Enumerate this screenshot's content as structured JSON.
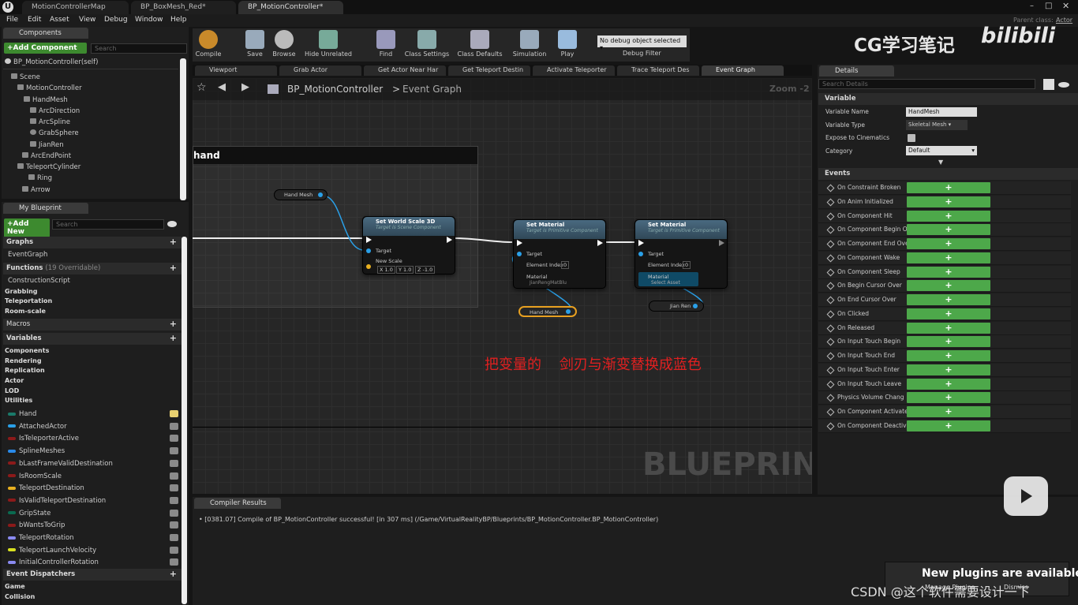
{
  "window": {
    "tabs": [
      "MotionControllerMap",
      "BP_BoxMesh_Red*",
      "BP_MotionController*"
    ],
    "parent_class_label": "Parent class:",
    "parent_class_value": "Actor"
  },
  "menu": [
    "File",
    "Edit",
    "Asset",
    "View",
    "Debug",
    "Window",
    "Help"
  ],
  "components_panel": {
    "title": "Components",
    "add_button": "+Add Component",
    "search_placeholder": "Search",
    "self_item": "BP_MotionController(self)",
    "tree": [
      "Scene",
      "MotionController",
      "HandMesh",
      "ArcDirection",
      "ArcSpline",
      "GrabSphere",
      "JianRen",
      "ArcEndPoint",
      "TeleportCylinder",
      "Ring",
      "Arrow"
    ]
  },
  "my_blueprint": {
    "title": "My Blueprint",
    "add_new": "+Add New",
    "search_placeholder": "Search",
    "graphs_label": "Graphs",
    "event_graph": "EventGraph",
    "functions_label": "Functions",
    "functions_overridable": "(19 Overridable)",
    "functions": [
      "ConstructionScript",
      "Grabbing",
      "Teleportation",
      "Room-scale"
    ],
    "macros_label": "Macros",
    "variables_label": "Variables",
    "variable_categories": [
      "Components",
      "Rendering",
      "Replication",
      "Actor",
      "LOD",
      "Utilities"
    ],
    "variables": [
      {
        "name": "Hand",
        "color": "#1a7a6a"
      },
      {
        "name": "AttachedActor",
        "color": "#2aa0e8"
      },
      {
        "name": "IsTeleporterActive",
        "color": "#8c1a1a"
      },
      {
        "name": "SplineMeshes",
        "color": "#2a8ae8"
      },
      {
        "name": "bLastFrameValidDestination",
        "color": "#8c1a1a"
      },
      {
        "name": "IsRoomScale",
        "color": "#8c1a1a"
      },
      {
        "name": "TeleportDestination",
        "color": "#e8b020"
      },
      {
        "name": "IsValidTeleportDestination",
        "color": "#8c1a1a"
      },
      {
        "name": "GripState",
        "color": "#0a6a50"
      },
      {
        "name": "bWantsToGrip",
        "color": "#8c1a1a"
      },
      {
        "name": "TeleportRotation",
        "color": "#8a8af0"
      },
      {
        "name": "TeleportLaunchVelocity",
        "color": "#d8e020"
      },
      {
        "name": "InitialControllerRotation",
        "color": "#8a8af0"
      }
    ],
    "event_dispatchers_label": "Event Dispatchers",
    "dispatcher_categories": [
      "Game",
      "Collision"
    ]
  },
  "toolbar": {
    "items": [
      "Compile",
      "Save",
      "Browse",
      "Hide Unrelated",
      "Find",
      "Class Settings",
      "Class Defaults",
      "Simulation",
      "Play"
    ],
    "debug_object": "No debug object selected",
    "debug_filter": "Debug Filter"
  },
  "watermark": {
    "cg_text": "CG学习笔记",
    "bili": "bilibili"
  },
  "graph_tabs": [
    "Viewport",
    "Grab Actor",
    "Get Actor Near Har",
    "Get Teleport Destin",
    "Activate Teleporter",
    "Trace Teleport Des",
    "Event Graph"
  ],
  "graph": {
    "breadcrumb_root": "BP_MotionController",
    "breadcrumb_leaf": "Event Graph",
    "zoom": "Zoom -2",
    "comment_title": "hand",
    "watermark": "BLUEPRINT",
    "annotation": "把变量的    剑刃与渐变替换成蓝色",
    "nodes": {
      "set_world_scale": {
        "title": "Set World Scale 3D",
        "subtitle": "Target is Scene Component",
        "target": "Target",
        "new_scale": "New Scale",
        "x": "1.0",
        "y": "1.0",
        "z": "-1.0"
      },
      "set_material_1": {
        "title": "Set Material",
        "subtitle": "Target is Primitive Component",
        "target": "Target",
        "element_index": "Element Index",
        "index_value": "0",
        "material": "Material",
        "material_value": "JianRengMatBlu"
      },
      "set_material_2": {
        "title": "Set Material",
        "subtitle": "Target is Primitive Component",
        "target": "Target",
        "element_index": "Element Index",
        "index_value": "0",
        "material": "Material",
        "material_value": "Select Asset"
      },
      "hand_mesh_1": "Hand Mesh",
      "hand_mesh_2": "Hand Mesh",
      "jian_ren": "Jian Ren"
    }
  },
  "details": {
    "title": "Details",
    "search_placeholder": "Search Details",
    "variable_section": "Variable",
    "fields": [
      {
        "label": "Variable Name",
        "value": "HandMesh"
      },
      {
        "label": "Variable Type",
        "value": "Skeletal Mesh"
      },
      {
        "label": "Expose to Cinematics",
        "value": ""
      },
      {
        "label": "Category",
        "value": "Default"
      }
    ],
    "events_section": "Events",
    "events": [
      "On Constraint Broken",
      "On Anim Initialized",
      "On Component Hit",
      "On Component Begin O",
      "On Component End Ove",
      "On Component Wake",
      "On Component Sleep",
      "On Begin Cursor Over",
      "On End Cursor Over",
      "On Clicked",
      "On Released",
      "On Input Touch Begin",
      "On Input Touch End",
      "On Input Touch Enter",
      "On Input Touch Leave",
      "Physics Volume Chang",
      "On Component Activate",
      "On Component Deactiva"
    ],
    "plus": "+"
  },
  "compiler": {
    "title": "Compiler Results",
    "log": "[0381.07] Compile of BP_MotionController successful! [in 307 ms] (/Game/VirtualRealityBP/Blueprints/BP_MotionController.BP_MotionController)"
  },
  "notification": {
    "title": "New plugins are available",
    "button": "Manage Plugins",
    "dismiss": "Dismiss"
  },
  "csdn_watermark": "CSDN @这个软件需要设计一下"
}
